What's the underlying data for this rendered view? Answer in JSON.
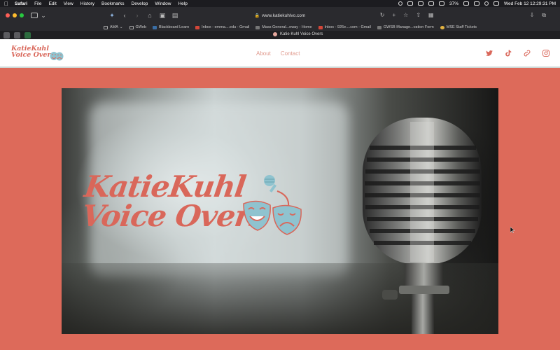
{
  "menubar": {
    "app": "Safari",
    "items": [
      "File",
      "Edit",
      "View",
      "History",
      "Bookmarks",
      "Develop",
      "Window",
      "Help"
    ],
    "battery": "37%",
    "clock": "Wed Feb 12  12:29:31 PM"
  },
  "toolbar": {
    "url": "www.katiekuhlvo.com"
  },
  "bookmarks": [
    {
      "label": "AMA",
      "icon": "folder-icon"
    },
    {
      "label": "GWeb",
      "icon": "folder-icon"
    },
    {
      "label": "Blackboard Learn",
      "icon": "blackboard-icon"
    },
    {
      "label": "Inbox - emma....edu - Gmail",
      "icon": "gmail-icon"
    },
    {
      "label": "Mass General...eway - Home",
      "icon": "page-icon"
    },
    {
      "label": "Inbox - 926e....com - Gmail",
      "icon": "gmail-icon"
    },
    {
      "label": "GWSB Manage...vation Form",
      "icon": "page-icon"
    },
    {
      "label": "MSE Staff Tickets",
      "icon": "smile-icon"
    }
  ],
  "tabs": {
    "active": "Katie Kuhl Voice Overs"
  },
  "site": {
    "logo_line1": "KatieKuhl",
    "logo_line2": "Voice Overs",
    "nav": [
      {
        "label": "About"
      },
      {
        "label": "Contact"
      }
    ],
    "social": [
      "twitter-icon",
      "tiktok-icon",
      "link-icon",
      "instagram-icon"
    ]
  },
  "hero": {
    "line1": "KatieKuhl",
    "line2": "Voice Overs"
  },
  "colors": {
    "brand_coral": "#dd6a5a",
    "logo_coral": "#d9675a",
    "mask_teal": "#8fc3cf",
    "nav_text": "#e09a8e"
  }
}
